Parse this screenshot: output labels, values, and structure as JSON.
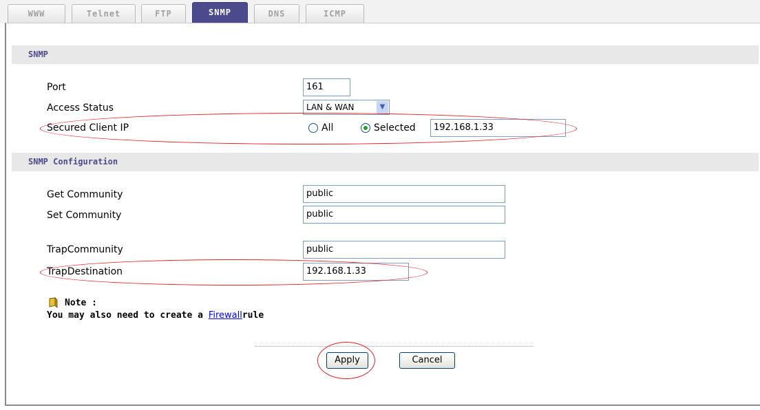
{
  "tabs": [
    {
      "label": "WWW"
    },
    {
      "label": "Telnet"
    },
    {
      "label": "FTP"
    },
    {
      "label": "SNMP",
      "active": true
    },
    {
      "label": "DNS"
    },
    {
      "label": "ICMP"
    }
  ],
  "snmp_section": {
    "title": "SNMP",
    "port_label": "Port",
    "port_value": "161",
    "access_label": "Access Status",
    "access_value": "LAN & WAN",
    "secured_label": "Secured Client IP",
    "radio_all": "All",
    "radio_selected": "Selected",
    "selected_option": "Selected",
    "secured_ip": "192.168.1.33"
  },
  "config_section": {
    "title": "SNMP Configuration",
    "get_label": "Get Community",
    "get_value": "public",
    "set_label": "Set Community",
    "set_value": "public",
    "trap_comm_label": "TrapCommunity",
    "trap_comm_value": "public",
    "trap_dest_label": "TrapDestination",
    "trap_dest_value": "192.168.1.33"
  },
  "note": {
    "title": "Note :",
    "text_before": "You may also need to create a ",
    "link": "Firewall",
    "text_after": "rule"
  },
  "buttons": {
    "apply": "Apply",
    "cancel": "Cancel"
  },
  "colors": {
    "active_tab": "#4a4a8c",
    "section_header_text": "#4a4a8c",
    "highlight_ellipse": "#e0202a",
    "link": "#0000ee"
  }
}
